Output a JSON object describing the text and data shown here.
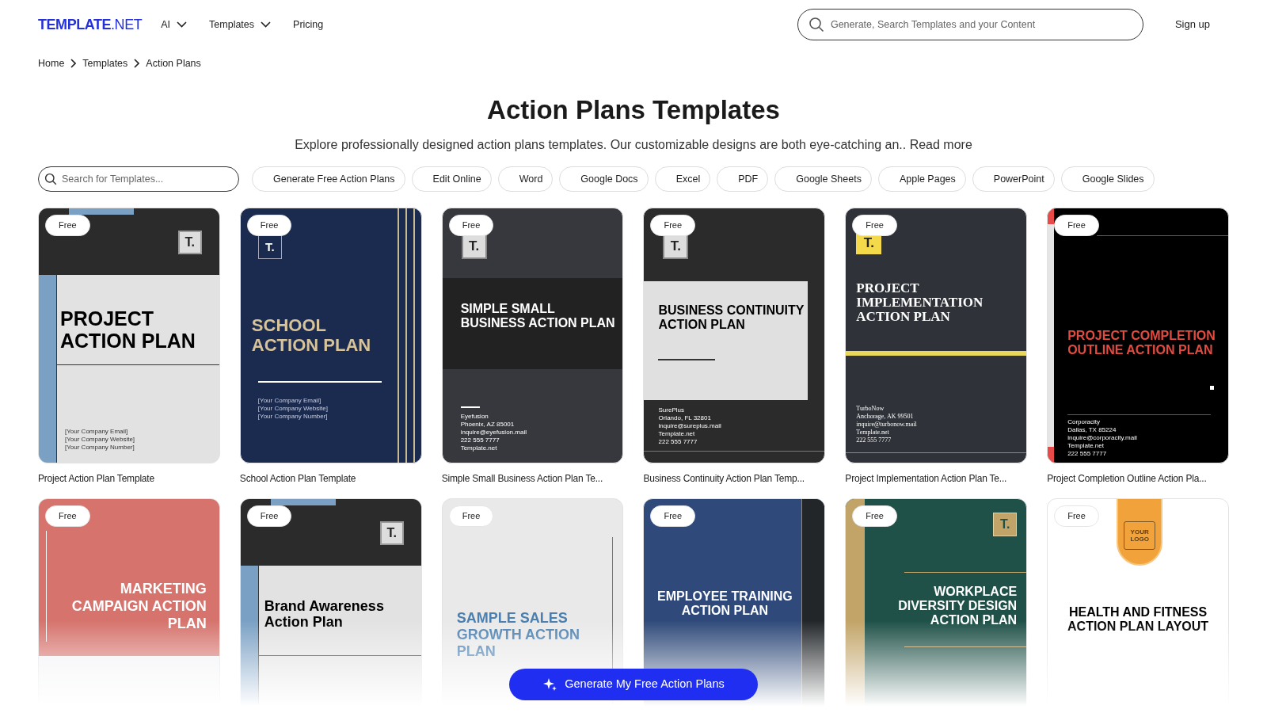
{
  "nav": {
    "logo_bold": "TEMPLATE",
    "logo_light": ".NET",
    "menu": [
      {
        "label": "AI",
        "dropdown": true
      },
      {
        "label": "Templates",
        "dropdown": true
      },
      {
        "label": "Pricing",
        "dropdown": false
      }
    ],
    "search": {
      "placeholder": "Generate, Search Templates and your Content"
    },
    "sign_up": "Sign up"
  },
  "breadcrumb": [
    "Home",
    "Templates",
    "Action Plans"
  ],
  "heading": "Action Plans Templates",
  "intro": {
    "text": "Explore professionally designed action plans templates. Our customizable designs are both eye-catching an..",
    "read_more": "Read more"
  },
  "filter_search": {
    "placeholder": "Search for Templates..."
  },
  "filters": [
    "Generate Free Action Plans",
    "Edit Online",
    "Word",
    "Google Docs",
    "Excel",
    "PDF",
    "Google Sheets",
    "Apple Pages",
    "PowerPoint",
    "Google Slides"
  ],
  "cards": [
    {
      "kind": "gray-split",
      "badge": "Free",
      "logo": "T.",
      "cover_title": "PROJECT ACTION PLAN",
      "contact": [
        "[Your Company Email]",
        "[Your Company Website]",
        "[Your Company Number]"
      ],
      "caption": "Project Action Plan Template"
    },
    {
      "kind": "navy",
      "badge": "Free",
      "logo": "T.",
      "cover_title": "SCHOOL ACTION PLAN",
      "contact": [
        "[Your Company Email]",
        "[Your Company Website]",
        "[Your Company Number]"
      ],
      "caption": "School Action Plan Template"
    },
    {
      "kind": "charcoal-band",
      "badge": "Free",
      "logo": "T.",
      "cover_title": "SIMPLE SMALL BUSINESS ACTION PLAN",
      "contact": [
        "Eyefusion",
        "Phoenix, AZ 85001",
        "inquire@eyefusion.mail",
        "222 555 7777",
        "Template.net"
      ],
      "caption": "Simple Small Business Action Plan Te..."
    },
    {
      "kind": "dark-panel",
      "badge": "Free",
      "logo": "T.",
      "cover_title": "BUSINESS CONTINUITY ACTION PLAN",
      "contact": [
        "SurePlus",
        "Orlando, FL 32801",
        "inquire@sureplus.mail",
        "Template.net",
        "222 555 7777"
      ],
      "caption": "Business Continuity Action Plan Temp..."
    },
    {
      "kind": "slate",
      "badge": "Free",
      "logo": "T.",
      "cover_title": "PROJECT IMPLEMENTATION ACTION PLAN",
      "contact": [
        "TurboNow",
        "Anchorage, AK 99501",
        "inquire@turbonow.mail",
        "Template.net",
        "222 555 7777"
      ],
      "caption": "Project Implementation Action Plan Te..."
    },
    {
      "kind": "black-red",
      "badge": "Free",
      "cover_title": "PROJECT COMPLETION OUTLINE ACTION PLAN",
      "contact": [
        "Corporacity",
        "Dallas, TX 85224",
        "inquire@corporacity.mail",
        "Template.net",
        "222 555 7777"
      ],
      "caption": "Project Completion Outline Action Pla..."
    },
    {
      "kind": "coral",
      "badge": "Free",
      "cover_title": "MARKETING CAMPAIGN ACTION PLAN"
    },
    {
      "kind": "gray-split-mixed",
      "badge": "Free",
      "logo": "T.",
      "cover_title": "Brand Awareness Action Plan"
    },
    {
      "kind": "light-blue",
      "badge": "Free",
      "cover_title": "SAMPLE SALES GROWTH ACTION PLAN"
    },
    {
      "kind": "royal",
      "badge": "Free",
      "cover_title": "EMPLOYEE TRAINING ACTION PLAN"
    },
    {
      "kind": "green",
      "badge": "Free",
      "logo": "T.",
      "cover_title": "WORKPLACE DIVERSITY DESIGN ACTION PLAN"
    },
    {
      "kind": "white-orange",
      "badge": "Free",
      "logo": "YOUR LOGO",
      "cover_title": "HEALTH AND FITNESS ACTION PLAN LAYOUT"
    }
  ],
  "generate_button": "Generate My Free Action Plans"
}
